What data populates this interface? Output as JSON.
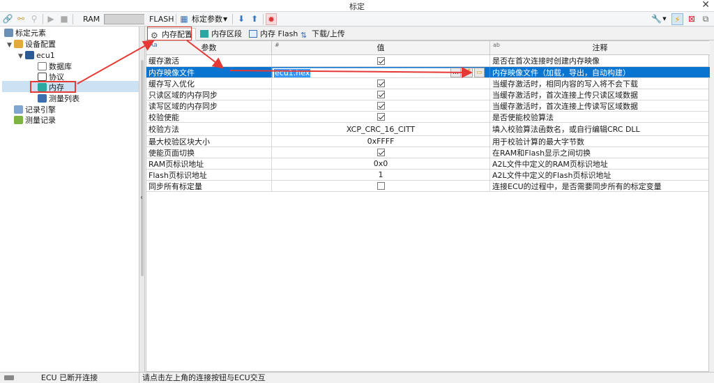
{
  "window": {
    "title": "标定"
  },
  "toolbar": {
    "ram_label": "RAM",
    "flash_label": "FLASH",
    "calib_params_label": "标定参数"
  },
  "tree": {
    "items": [
      {
        "label": "标定元素"
      },
      {
        "label": "设备配置"
      },
      {
        "label": "ecu1"
      },
      {
        "label": "数据库"
      },
      {
        "label": "协议"
      },
      {
        "label": "内存"
      },
      {
        "label": "测量列表"
      },
      {
        "label": "记录引擎"
      },
      {
        "label": "测量记录"
      }
    ]
  },
  "tabs": [
    {
      "label": "内存配置"
    },
    {
      "label": "内存区段"
    },
    {
      "label": "内存 Flash"
    },
    {
      "label": "下载/上传"
    }
  ],
  "grid": {
    "headers": {
      "param": "参数",
      "value": "值",
      "comment": "注释"
    },
    "rows": [
      {
        "param": "缓存激活",
        "value": "",
        "check": true,
        "comment": "是否在首次连接时创建内存映像"
      },
      {
        "param": "内存映像文件",
        "value": "ecu1.hex",
        "comment": "内存映像文件（加载，导出，自动构建）"
      },
      {
        "param": "缓存写入优化",
        "value": "",
        "check": true,
        "comment": "当缓存激活时，相同内容的写入将不会下载"
      },
      {
        "param": "只读区域的内存同步",
        "value": "",
        "check": true,
        "comment": "当缓存激活时，首次连接上传只读区域数据"
      },
      {
        "param": "读写区域的内存同步",
        "value": "",
        "check": true,
        "comment": "当缓存激活时，首次连接上传读写区域数据"
      },
      {
        "param": "校验使能",
        "value": "",
        "check": true,
        "comment": "是否使能校验算法"
      },
      {
        "param": "校验方法",
        "value": "XCP_CRC_16_CITT",
        "comment": "填入校验算法函数名，或自行编辑CRC DLL"
      },
      {
        "param": "最大校验区块大小",
        "value": "0xFFFF",
        "comment": "用于校验计算的最大字节数"
      },
      {
        "param": "使能页面切换",
        "value": "",
        "check": true,
        "comment": "在RAM和Flash显示之间切换"
      },
      {
        "param": "RAM页标识地址",
        "value": "0x0",
        "comment": "A2L文件中定义的RAM页标识地址"
      },
      {
        "param": "Flash页标识地址",
        "value": "1",
        "comment": "A2L文件中定义的Flash页标识地址"
      },
      {
        "param": "同步所有标定量",
        "value": "",
        "check": false,
        "comment": "连接ECU的过程中，是否需要同步所有的标定变量"
      }
    ]
  },
  "status": {
    "ecu": "ECU 已断开连接",
    "message": "请点击左上角的连接按钮与ECU交互"
  },
  "colors": {
    "selection": "#0a74d1",
    "annotation": "#e53935"
  }
}
